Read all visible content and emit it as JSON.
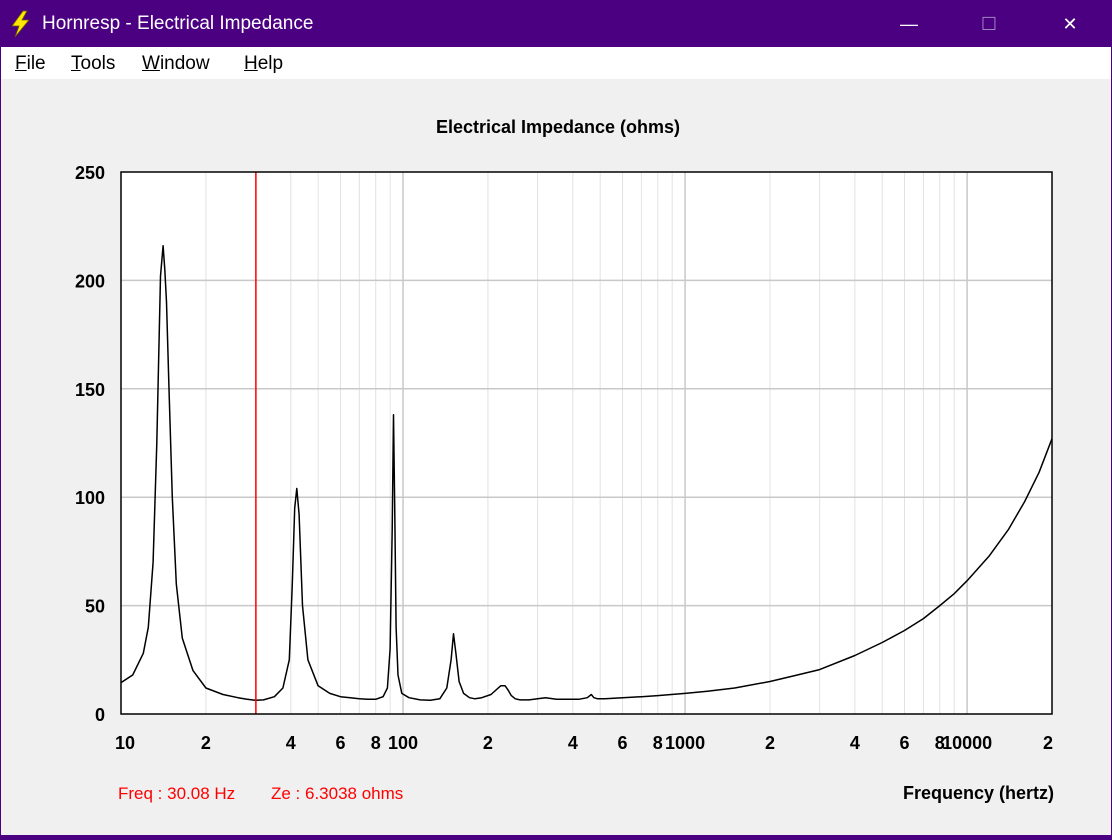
{
  "window": {
    "title": "Hornresp - Electrical Impedance",
    "controls": {
      "minimize": "—",
      "maximize": "☐",
      "close": "✕"
    }
  },
  "menu": {
    "items": [
      {
        "mnemonic": "F",
        "rest": "ile"
      },
      {
        "mnemonic": "T",
        "rest": "ools"
      },
      {
        "mnemonic": "W",
        "rest": "indow"
      },
      {
        "mnemonic": "H",
        "rest": "elp"
      }
    ]
  },
  "readout": {
    "freq": "Freq : 30.08 Hz",
    "ze": "Ze : 6.3038 ohms"
  },
  "colors": {
    "title_bar": "#4b0082",
    "cursor": "#ff0000",
    "readout_text": "#ff0000",
    "curve": "#000000",
    "grid": "#c8c8c8"
  },
  "chart_data": {
    "type": "line",
    "title": "Electrical Impedance (ohms)",
    "xlabel": "Frequency (hertz)",
    "ylabel": "",
    "xscale": "log",
    "xlim": [
      10,
      20000
    ],
    "ylim": [
      0,
      250
    ],
    "grid": true,
    "y_ticks": [
      0,
      50,
      100,
      150,
      200,
      250
    ],
    "y_tick_labels": [
      "0",
      "50",
      "100",
      "150",
      "200",
      "250"
    ],
    "x_ticks": [
      10,
      20,
      40,
      60,
      80,
      100,
      200,
      400,
      600,
      800,
      1000,
      2000,
      4000,
      6000,
      8000,
      10000,
      20000
    ],
    "x_tick_labels": [
      "10",
      "2",
      "4",
      "6",
      "8",
      "100",
      "2",
      "4",
      "6",
      "8",
      "1000",
      "2",
      "4",
      "6",
      "8",
      "10000",
      "2"
    ],
    "cursor_x": 30.08,
    "series": [
      {
        "x": [
          10,
          11,
          12,
          12.5,
          13,
          13.4,
          13.8,
          14.1,
          14.3,
          14.5,
          14.8,
          15.2,
          15.7,
          16.5,
          18,
          20,
          23,
          26,
          28,
          30.08,
          32,
          35,
          37.5,
          39.5,
          40.5,
          41.3,
          42,
          42.8,
          44,
          46,
          50,
          55,
          60,
          65,
          70,
          75,
          80,
          85,
          88,
          90,
          91.5,
          92.5,
          93.5,
          94.5,
          96,
          99,
          105,
          115,
          125,
          135,
          143,
          148,
          151,
          154,
          158,
          164,
          172,
          180,
          190,
          205,
          222,
          230,
          236,
          242,
          250,
          260,
          280,
          300,
          320,
          350,
          380,
          420,
          450,
          465,
          475,
          490,
          520,
          600,
          700,
          800,
          1000,
          1200,
          1500,
          2000,
          2500,
          3000,
          4000,
          5000,
          6000,
          7000,
          8000,
          9000,
          10000,
          12000,
          14000,
          16000,
          18000,
          20000
        ],
        "y": [
          14.5,
          18,
          28,
          40,
          70,
          125,
          202,
          216,
          205,
          190,
          150,
          100,
          60,
          35,
          20,
          12,
          9,
          7.5,
          6.8,
          6.3,
          6.5,
          8,
          12,
          25,
          60,
          95,
          104,
          92,
          50,
          25,
          13,
          9.5,
          8,
          7.5,
          7,
          6.8,
          6.8,
          8,
          12,
          30,
          85,
          138,
          92,
          40,
          18,
          9.5,
          7.5,
          6.5,
          6.3,
          7,
          12,
          25,
          37,
          28,
          15,
          9.5,
          7.5,
          7,
          7.5,
          9,
          13,
          13,
          11,
          8.5,
          7,
          6.5,
          6.5,
          7,
          7.5,
          6.8,
          6.8,
          6.8,
          7.5,
          9,
          7.5,
          7,
          7,
          7.5,
          8,
          8.5,
          9.5,
          10.5,
          12,
          15,
          18,
          20.5,
          27,
          33,
          38.5,
          44,
          50,
          55.5,
          61.5,
          73,
          85,
          98,
          111.5,
          127
        ]
      }
    ]
  }
}
